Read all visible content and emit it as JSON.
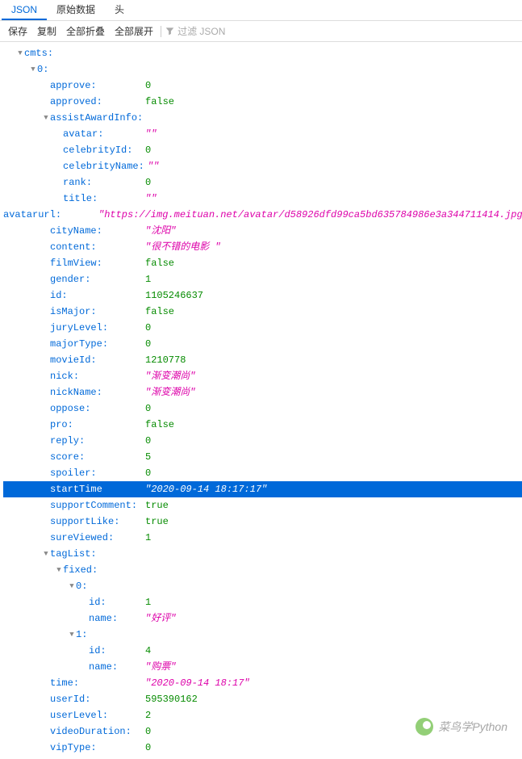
{
  "tabs": [
    "JSON",
    "原始数据",
    "头"
  ],
  "toolbar": {
    "save": "保存",
    "copy": "复制",
    "collapseAll": "全部折叠",
    "expandAll": "全部展开",
    "filterPlaceholder": "过滤 JSON"
  },
  "tree": {
    "root": "cmts",
    "index": "0",
    "item": {
      "approve": {
        "v": "0",
        "t": "num"
      },
      "approved": {
        "v": "false",
        "t": "bool"
      },
      "assistAwardInfo": {
        "avatar": {
          "v": "\"\"",
          "t": "str"
        },
        "celebrityId": {
          "v": "0",
          "t": "num"
        },
        "celebrityName": {
          "v": "\"\"",
          "t": "str"
        },
        "rank": {
          "v": "0",
          "t": "num"
        },
        "title": {
          "v": "\"\"",
          "t": "str"
        }
      },
      "avatarurl": {
        "v": "\"https://img.meituan.net/avatar/d58926dfd99ca5bd635784986e3a344711414.jpg\"",
        "t": "str"
      },
      "cityName": {
        "v": "\"沈阳\"",
        "t": "str"
      },
      "content": {
        "v": "\"很不错的电影 \"",
        "t": "str"
      },
      "filmView": {
        "v": "false",
        "t": "bool"
      },
      "gender": {
        "v": "1",
        "t": "num"
      },
      "id": {
        "v": "1105246637",
        "t": "num"
      },
      "isMajor": {
        "v": "false",
        "t": "bool"
      },
      "juryLevel": {
        "v": "0",
        "t": "num"
      },
      "majorType": {
        "v": "0",
        "t": "num"
      },
      "movieId": {
        "v": "1210778",
        "t": "num"
      },
      "nick": {
        "v": "\"渐变潮尚\"",
        "t": "str"
      },
      "nickName": {
        "v": "\"渐变潮尚\"",
        "t": "str"
      },
      "oppose": {
        "v": "0",
        "t": "num"
      },
      "pro": {
        "v": "false",
        "t": "bool"
      },
      "reply": {
        "v": "0",
        "t": "num"
      },
      "score": {
        "v": "5",
        "t": "num"
      },
      "spoiler": {
        "v": "0",
        "t": "num"
      },
      "startTime": {
        "v": "\"2020-09-14 18:17:17\"",
        "t": "str",
        "selected": true
      },
      "supportComment": {
        "v": "true",
        "t": "bool"
      },
      "supportLike": {
        "v": "true",
        "t": "bool"
      },
      "sureViewed": {
        "v": "1",
        "t": "num"
      },
      "tagList": {
        "fixed": [
          {
            "id": {
              "v": "1",
              "t": "num"
            },
            "name": {
              "v": "\"好评\"",
              "t": "str"
            }
          },
          {
            "id": {
              "v": "4",
              "t": "num"
            },
            "name": {
              "v": "\"购票\"",
              "t": "str"
            }
          }
        ]
      },
      "time": {
        "v": "\"2020-09-14 18:17\"",
        "t": "str"
      },
      "userId": {
        "v": "595390162",
        "t": "num"
      },
      "userLevel": {
        "v": "2",
        "t": "num"
      },
      "videoDuration": {
        "v": "0",
        "t": "num"
      },
      "vipType": {
        "v": "0",
        "t": "num"
      }
    }
  },
  "watermark": "菜鸟学Python"
}
